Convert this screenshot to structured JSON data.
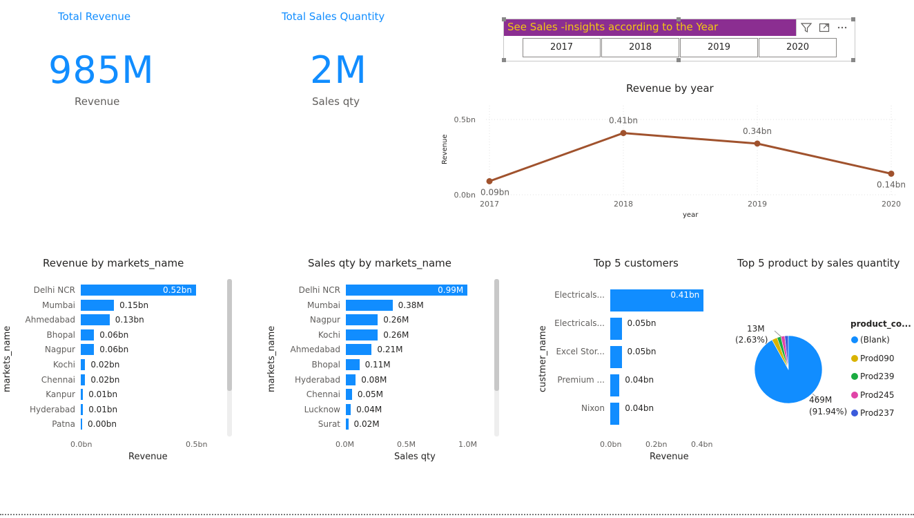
{
  "kpis": [
    {
      "title": "Total Revenue",
      "value": "985M",
      "label": "Revenue"
    },
    {
      "title": "Total Sales Quantity",
      "value": "2M",
      "label": "Sales qty"
    }
  ],
  "slicer": {
    "title": "See Sales -insights according to the Year",
    "options": [
      "2017",
      "2018",
      "2019",
      "2020"
    ],
    "icons": [
      "filter-icon",
      "focus-mode-icon",
      "more-options-icon"
    ]
  },
  "colors": {
    "accent": "#118DFF",
    "line": "#A0522D",
    "slicer_header": "#8B2E91",
    "slicer_title": "#F2C811"
  },
  "chart_data": [
    {
      "id": "revenue_by_year",
      "type": "line",
      "title": "Revenue by year",
      "xlabel": "year",
      "ylabel": "Revenue",
      "x": [
        "2017",
        "2018",
        "2019",
        "2020"
      ],
      "values": [
        0.09,
        0.41,
        0.34,
        0.14
      ],
      "data_labels": [
        "0.09bn",
        "0.41bn",
        "0.34bn",
        "0.14bn"
      ],
      "yticks": [
        "0.0bn",
        "0.5bn"
      ],
      "ylim": [
        0,
        0.5
      ],
      "grid": true
    },
    {
      "id": "revenue_by_market",
      "type": "bar",
      "orientation": "horizontal",
      "title": "Revenue by markets_name",
      "xlabel": "Revenue",
      "ylabel": "markets_name",
      "categories": [
        "Delhi NCR",
        "Mumbai",
        "Ahmedabad",
        "Bhopal",
        "Nagpur",
        "Kochi",
        "Chennai",
        "Kanpur",
        "Hyderabad",
        "Patna"
      ],
      "values": [
        0.52,
        0.15,
        0.13,
        0.06,
        0.06,
        0.02,
        0.02,
        0.01,
        0.01,
        0.0
      ],
      "data_labels": [
        "0.52bn",
        "0.15bn",
        "0.13bn",
        "0.06bn",
        "0.06bn",
        "0.02bn",
        "0.02bn",
        "0.01bn",
        "0.01bn",
        "0.00bn"
      ],
      "xticks": [
        "0.0bn",
        "0.5bn"
      ],
      "xlim": [
        0,
        0.52
      ]
    },
    {
      "id": "sales_qty_by_market",
      "type": "bar",
      "orientation": "horizontal",
      "title": "Sales qty by markets_name",
      "xlabel": "Sales qty",
      "ylabel": "markets_name",
      "categories": [
        "Delhi NCR",
        "Mumbai",
        "Nagpur",
        "Kochi",
        "Ahmedabad",
        "Bhopal",
        "Hyderabad",
        "Chennai",
        "Lucknow",
        "Surat"
      ],
      "values": [
        0.99,
        0.38,
        0.26,
        0.26,
        0.21,
        0.11,
        0.08,
        0.05,
        0.04,
        0.02
      ],
      "data_labels": [
        "0.99M",
        "0.38M",
        "0.26M",
        "0.26M",
        "0.21M",
        "0.11M",
        "0.08M",
        "0.05M",
        "0.04M",
        "0.02M"
      ],
      "xticks": [
        "0.0M",
        "0.5M",
        "1.0M"
      ],
      "xlim": [
        0,
        1.0
      ]
    },
    {
      "id": "top5_customers",
      "type": "bar",
      "orientation": "horizontal",
      "title": "Top 5 customers",
      "xlabel": "Revenue",
      "ylabel": "custmer_name",
      "categories": [
        "Electricals...",
        "Electricals...",
        "Excel Stor...",
        "Premium ...",
        "Nixon"
      ],
      "values": [
        0.41,
        0.05,
        0.05,
        0.04,
        0.04
      ],
      "data_labels": [
        "0.41bn",
        "0.05bn",
        "0.05bn",
        "0.04bn",
        "0.04bn"
      ],
      "xticks": [
        "0.0bn",
        "0.2bn",
        "0.4bn"
      ],
      "xlim": [
        0,
        0.4
      ]
    },
    {
      "id": "top5_products",
      "type": "pie",
      "title": "Top 5 product by sales quantity",
      "legend_title": "product_co...",
      "legend_position": "right",
      "labels": [
        "(Blank)",
        "Prod090",
        "Prod239",
        "Prod245",
        "Prod237"
      ],
      "values": [
        91.94,
        2.63,
        1.9,
        1.8,
        1.73
      ],
      "colors": [
        "#118DFF",
        "#D9B300",
        "#1AAB40",
        "#E66C37",
        "#3B5BDB"
      ],
      "legend_colors": [
        "#118DFF",
        "#D9B300",
        "#1AAB40",
        "#E044A7",
        "#3B5BDB"
      ],
      "data_labels": [
        {
          "value": "469M",
          "percent": "(91.94%)"
        },
        {
          "value": "13M",
          "percent": "(2.63%)"
        }
      ]
    }
  ]
}
